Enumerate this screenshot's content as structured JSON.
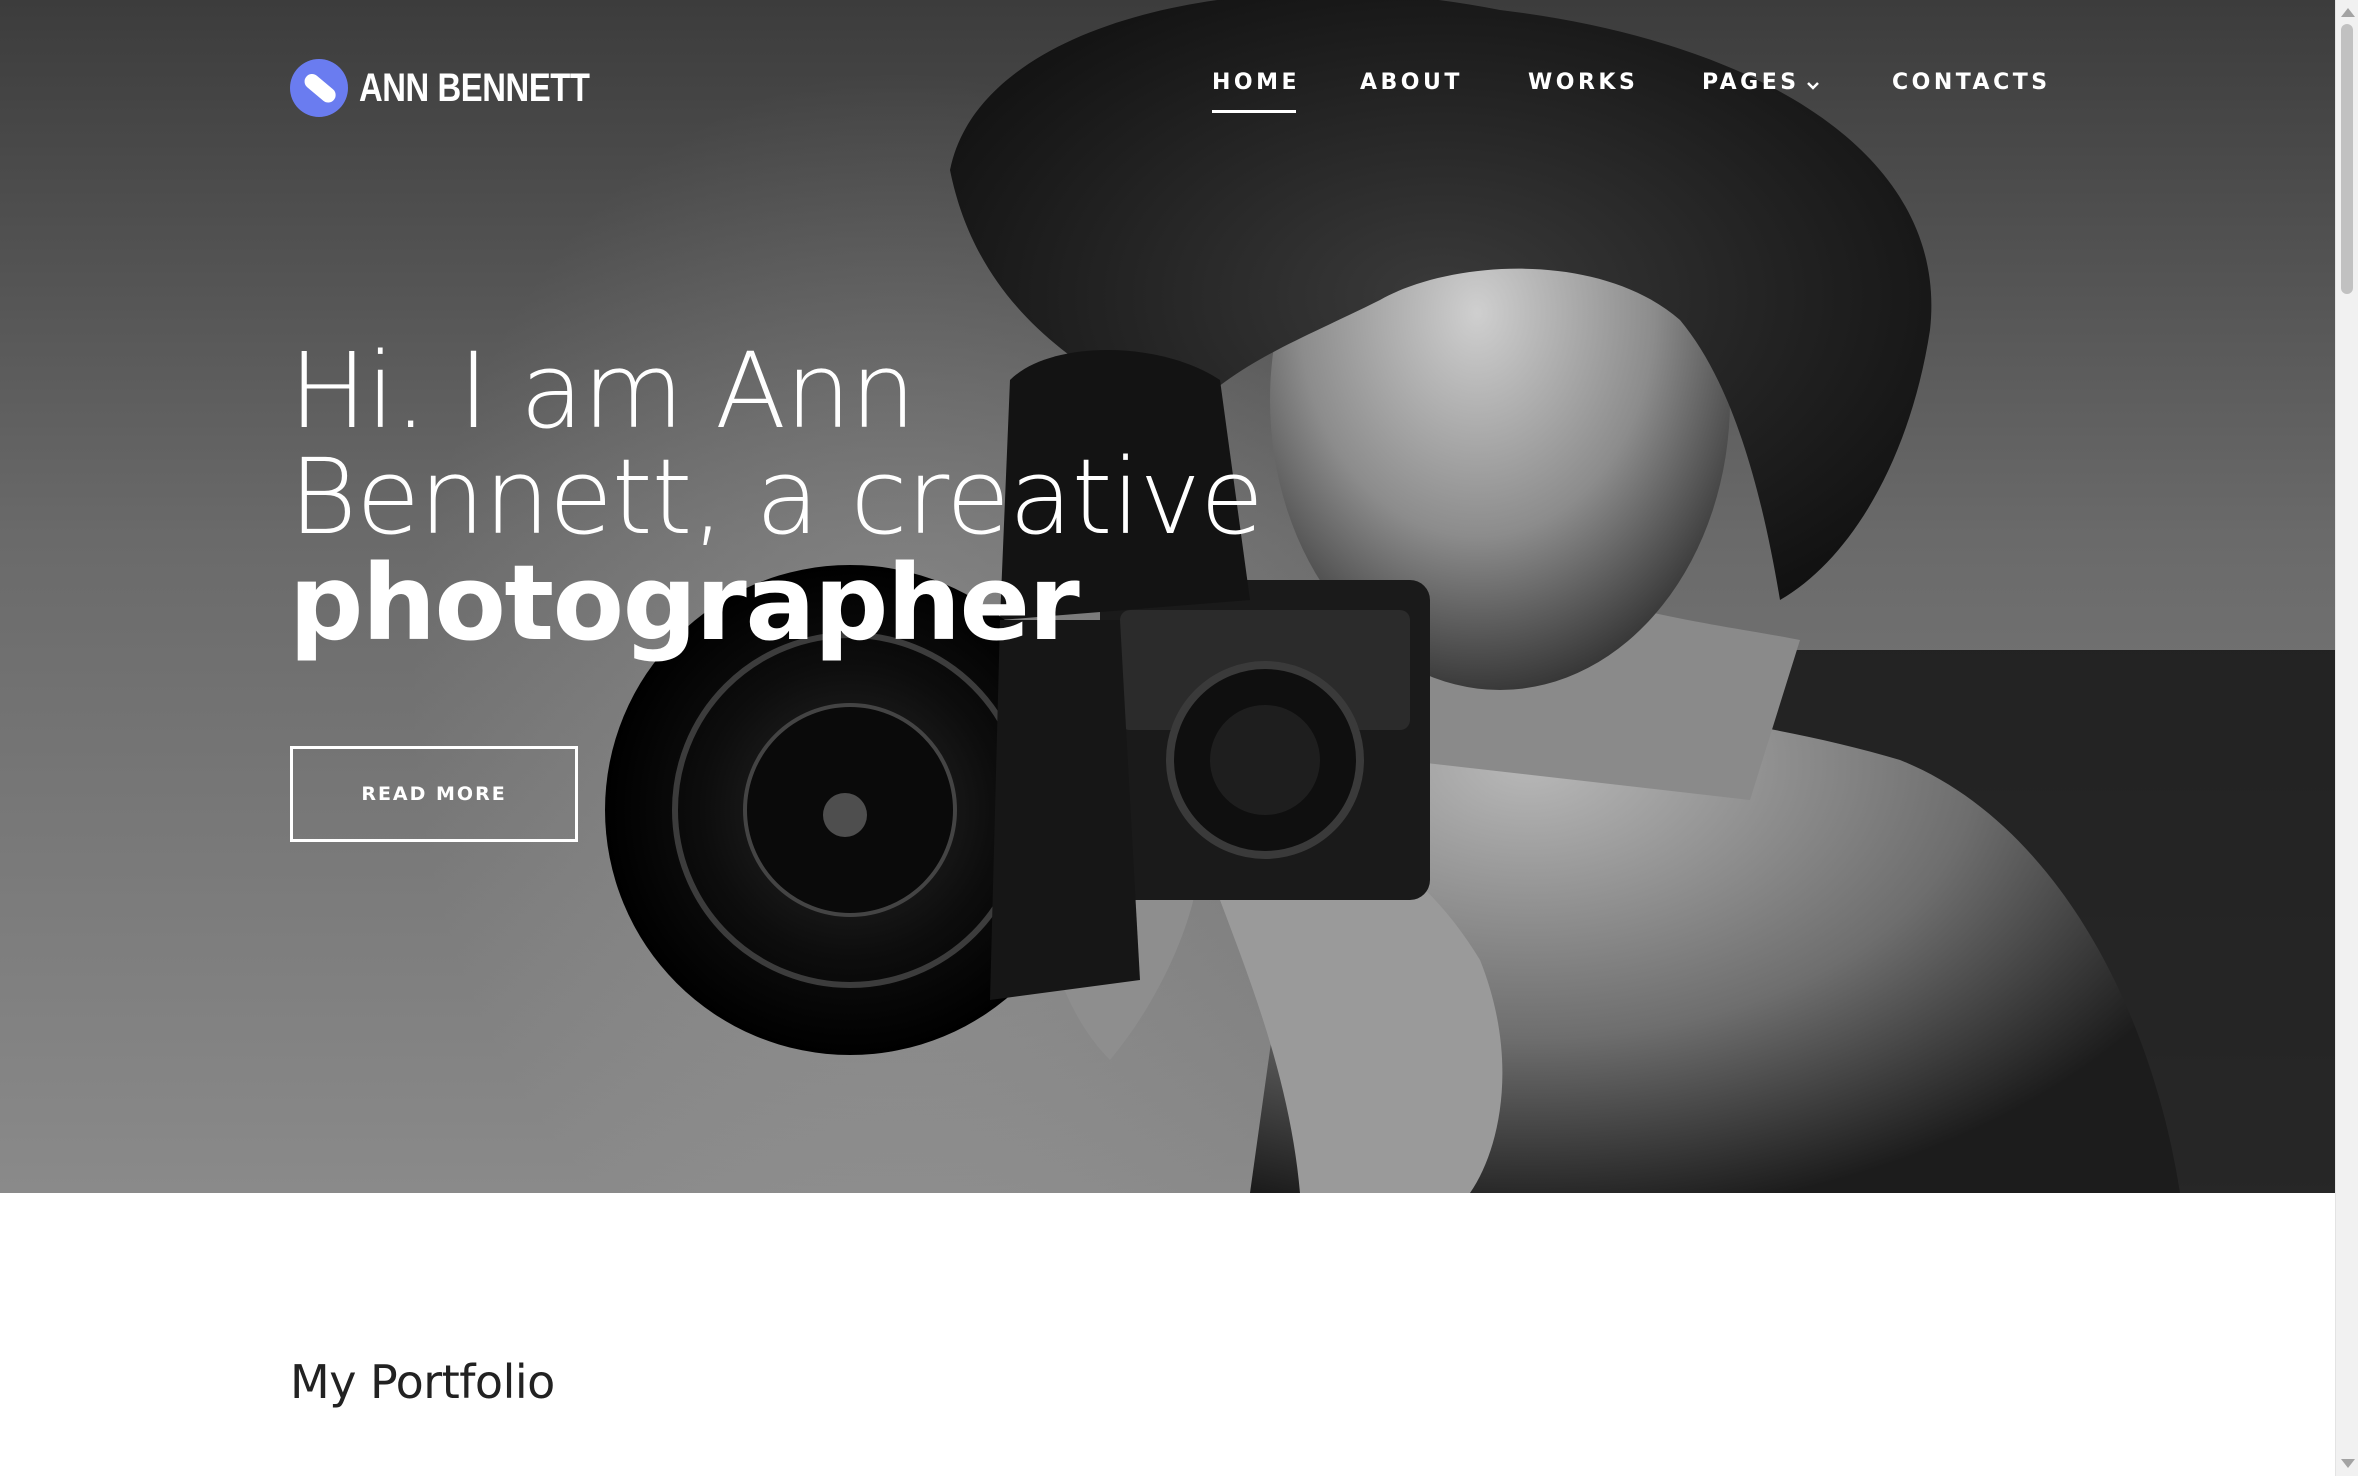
{
  "header": {
    "logo_text": "ANN BENNETT",
    "logo_color": "#6a7cf0"
  },
  "nav": {
    "items": [
      {
        "label": "HOME",
        "active": true
      },
      {
        "label": "ABOUT",
        "active": false
      },
      {
        "label": "WORKS",
        "active": false
      },
      {
        "label": "PAGES",
        "active": false,
        "has_dropdown": true
      },
      {
        "label": "CONTACTS",
        "active": false
      }
    ]
  },
  "hero": {
    "line1": "Hi. I am Ann",
    "line2": "Bennett, a creative",
    "line3": "photographer",
    "button_label": "READ MORE",
    "image_description_icon": "photographer-with-camera-image"
  },
  "portfolio": {
    "title": "My Portfolio"
  },
  "colors": {
    "text_light": "#ffffff",
    "heading_dark": "#222222",
    "accent": "#6a7cf0"
  }
}
